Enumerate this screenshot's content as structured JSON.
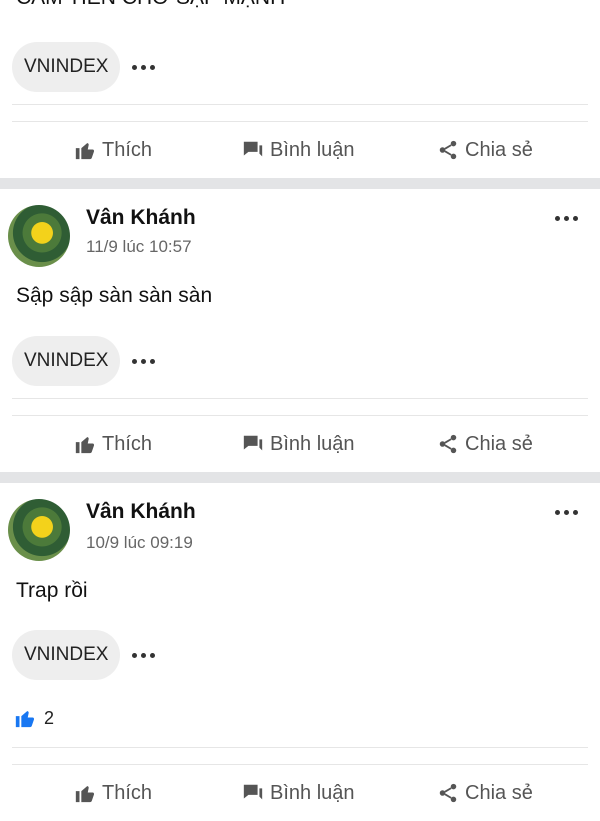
{
  "actions": {
    "like": "Thích",
    "comment": "Bình luận",
    "share": "Chia sẻ"
  },
  "posts": [
    {
      "text": "CẮM TIỀN CHỜ SẬP MẠNH",
      "tag": "VNINDEX"
    },
    {
      "author": "Vân Khánh",
      "time": "11/9 lúc 10:57",
      "text": "Sập sập sàn sàn sàn",
      "tag": "VNINDEX"
    },
    {
      "author": "Vân Khánh",
      "time": "10/9 lúc 09:19",
      "text": "Trap rồi",
      "tag": "VNINDEX",
      "like_count": "2"
    }
  ],
  "icons": {
    "like": "thumbs-up-icon",
    "comment": "comment-icon",
    "share": "share-icon",
    "more": "more-icon"
  },
  "colors": {
    "separator": "#e3e4e6",
    "like_blue": "#1877f2"
  }
}
